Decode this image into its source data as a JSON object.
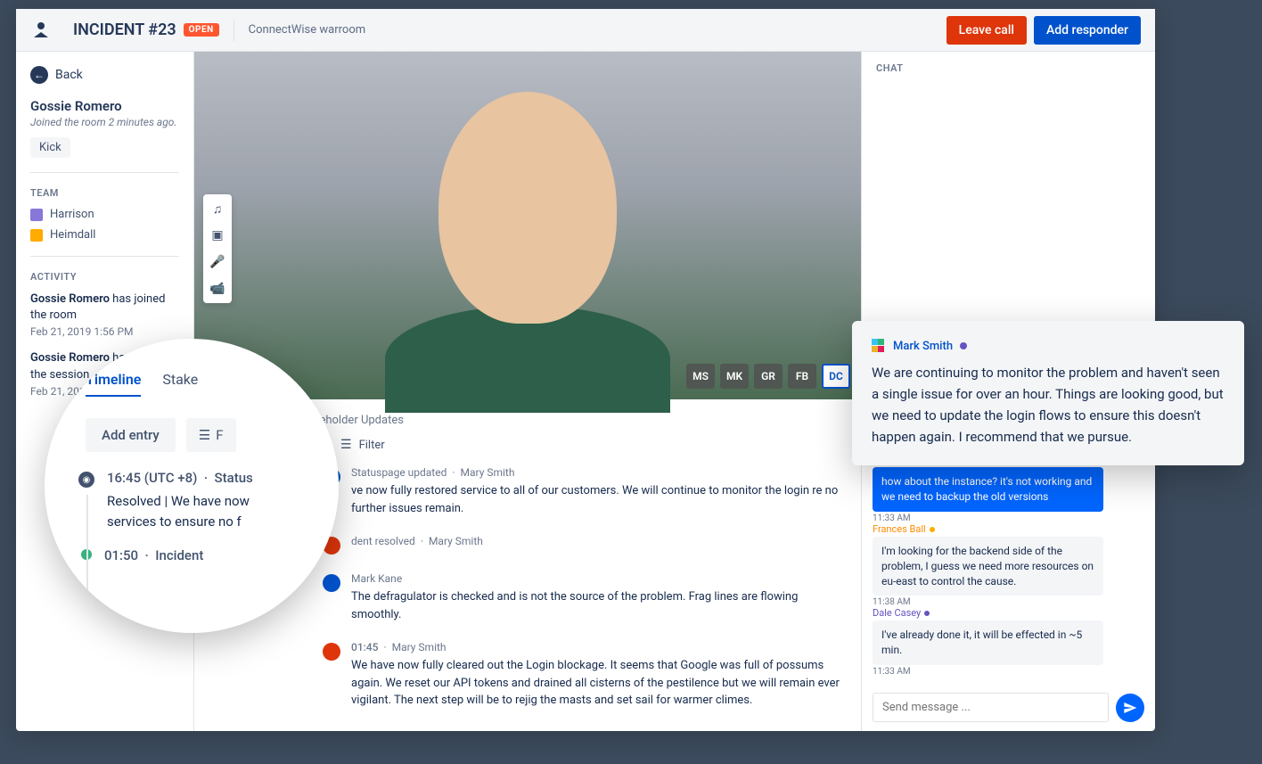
{
  "header": {
    "incident_title": "INCIDENT #23",
    "status_badge": "OPEN",
    "room_name": "ConnectWise warroom",
    "leave_call": "Leave call",
    "add_responder": "Add responder"
  },
  "sidebar": {
    "back": "Back",
    "person": {
      "name": "Gossie Romero",
      "joined": "Joined the room 2 minutes ago.",
      "kick": "Kick"
    },
    "team_label": "TEAM",
    "team": [
      {
        "name": "Harrison",
        "color": "#8777d9"
      },
      {
        "name": "Heimdall",
        "color": "#ffab00"
      }
    ],
    "activity_label": "ACTIVITY",
    "activity": [
      {
        "actor": "Gossie Romero",
        "action": " has joined the room",
        "time": "Feb 21, 2019 1:56 PM"
      },
      {
        "actor": "Gossie Romero",
        "action": " has started the session",
        "time": "Feb 21, 2019 1:55 PM"
      }
    ]
  },
  "video": {
    "participants": [
      "MS",
      "MK",
      "GR",
      "FB",
      "DC"
    ],
    "active_participant": "DC"
  },
  "timeline_overlay": {
    "tabs": [
      "Timeline",
      "Stake"
    ],
    "active_tab": "Timeline",
    "add_entry": "Add entry",
    "filter_label": "F",
    "entries": [
      {
        "time": "16:45 (UTC +8)",
        "label": "Status",
        "body": "Resolved  |  We have now",
        "body2": "services to ensure no f"
      },
      {
        "time": "01:50",
        "label": "Incident"
      }
    ]
  },
  "timeline": {
    "heading_shadow": "keholder Updates",
    "filter": "Filter",
    "entries": [
      {
        "meta_time": "",
        "meta_label": "Statuspage updated",
        "author": "Mary Smith",
        "body": "ve now fully restored service to all of our customers. We will continue to monitor the login re no further issues remain."
      },
      {
        "meta_label": "dent resolved",
        "author": "Mary Smith",
        "body": ""
      },
      {
        "author": "Mark Kane",
        "body": "The defragulator is checked and is not the source of the problem. Frag lines are flowing smoothly."
      },
      {
        "meta_time": "01:45",
        "author": "Mary Smith",
        "body": "We have now fully cleared out the Login blockage. It seems that Google was full of possums again. We reset our API tokens and drained all cisterns of the pestilence but we will remain ever vigilant. The next step will be to rejig the masts and set sail for warmer climes."
      }
    ]
  },
  "chat": {
    "header": "CHAT",
    "overlay_msg": {
      "author": "Mark Smith",
      "body": "We are continuing to monitor the problem and haven't seen a single issue for over an hour. Things are looking good, but we need to update the login flows to ensure this doesn't happen again. I recommend that we pursue."
    },
    "messages": [
      {
        "side": "right",
        "bubble_class": "blue",
        "body": "how about the instance? it's not working and we need to backup the old versions",
        "time": "11:33 AM"
      },
      {
        "side": "left",
        "author": "Frances Ball",
        "author_class": "orange",
        "bubble_class": "gray",
        "body": "I'm looking for the backend side of the problem, I guess we need more resources on eu-east to control the cause.",
        "time": "11:38 AM"
      },
      {
        "side": "left",
        "author": "Dale Casey",
        "author_class": "purple",
        "bubble_class": "gray",
        "body": "I've already done it, it will be effected in ~5 min.",
        "time": "11:33 AM"
      }
    ],
    "input_placeholder": "Send message ..."
  }
}
